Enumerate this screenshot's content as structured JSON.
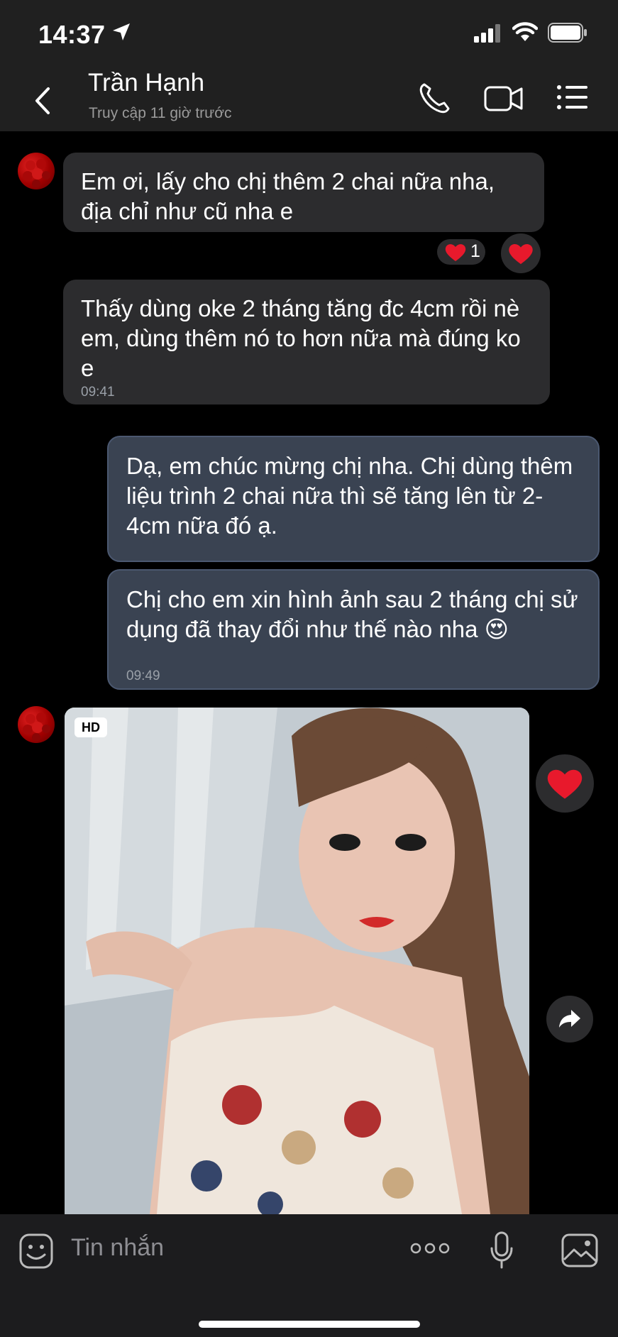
{
  "status_bar": {
    "time": "14:37"
  },
  "header": {
    "contact_name": "Trần Hạnh",
    "last_seen": "Truy cập 11 giờ trước"
  },
  "messages": [
    {
      "side": "in",
      "text": "Em ơi, lấy cho chị thêm 2 chai nữa nha, địa chỉ như cũ nha e",
      "reaction_count": "1"
    },
    {
      "side": "in",
      "text": "Thấy dùng oke 2 tháng tăng đc 4cm rồi nè em, dùng thêm nó to hơn nữa mà đúng ko e",
      "time": "09:41"
    },
    {
      "side": "out",
      "text": "Dạ, em chúc mừng chị nha. Chị dùng thêm liệu trình 2 chai nữa thì sẽ tăng lên từ 2-4cm nữa đó ạ."
    },
    {
      "side": "out",
      "text": "Chị cho em xin hình ảnh sau 2 tháng chị sử dụng đã thay đổi như thế nào nha 😍",
      "time": "09:49"
    }
  ],
  "photo": {
    "badge": "HD"
  },
  "input": {
    "placeholder": "Tin nhắn"
  },
  "colors": {
    "incoming_bubble": "#2c2c2e",
    "outgoing_bubble": "#3a4352",
    "heart": "#e8192c"
  }
}
